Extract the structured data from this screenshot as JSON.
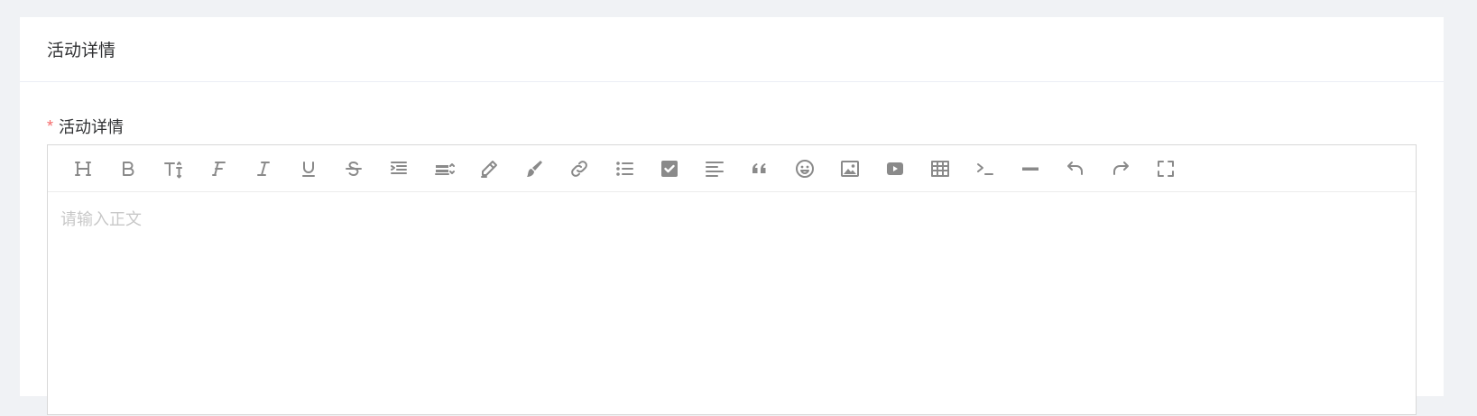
{
  "card": {
    "title": "活动详情"
  },
  "field": {
    "label": "活动详情",
    "required_mark": "*"
  },
  "editor": {
    "placeholder": "请输入正文",
    "value": "",
    "toolbar": [
      "heading-icon",
      "bold-icon",
      "font-size-icon",
      "font-family-icon",
      "italic-icon",
      "underline-icon",
      "strikethrough-icon",
      "indent-icon",
      "line-height-icon",
      "font-color-icon",
      "background-color-icon",
      "link-icon",
      "bullet-list-icon",
      "checkbox-icon",
      "align-icon",
      "quote-icon",
      "emoji-icon",
      "image-icon",
      "video-icon",
      "table-icon",
      "code-icon",
      "divider-icon",
      "undo-icon",
      "redo-icon",
      "fullscreen-icon"
    ]
  },
  "colors": {
    "required": "#f56c6c",
    "icon": "#8a8a8a",
    "background": "#f0f2f5"
  }
}
